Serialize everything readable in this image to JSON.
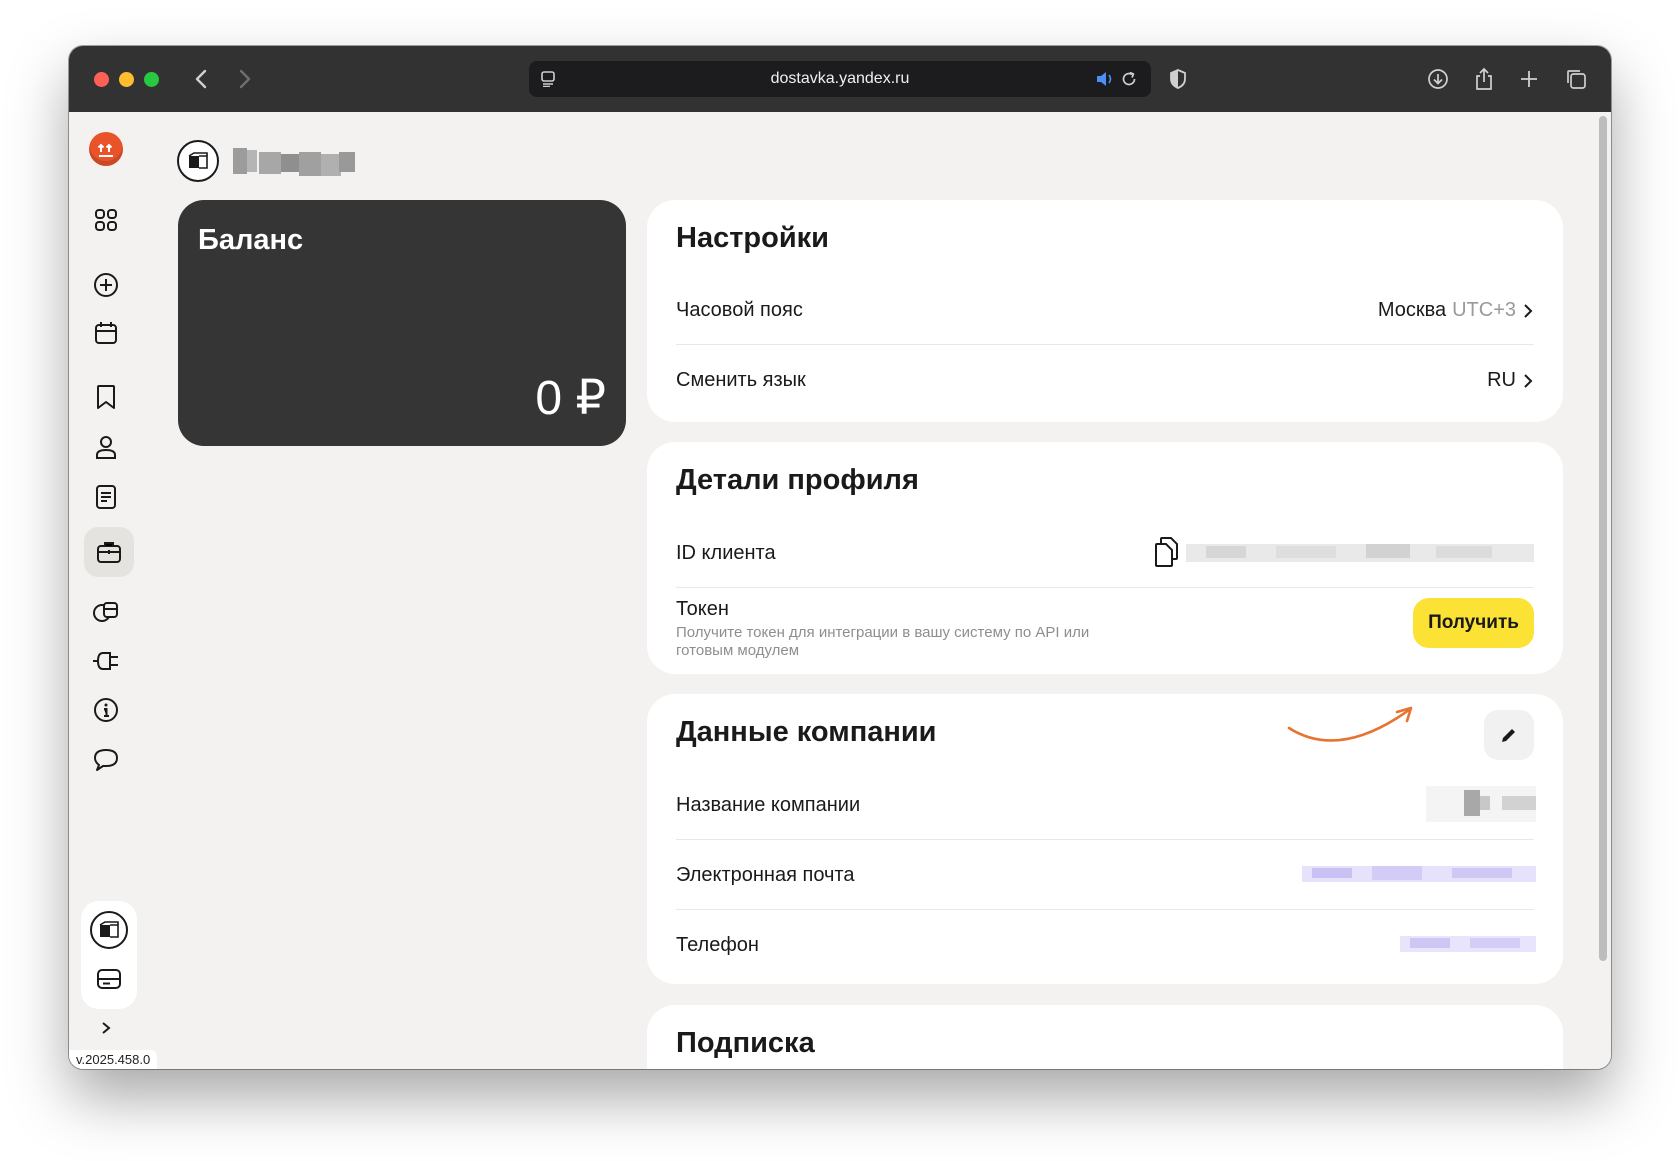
{
  "browser": {
    "url": "dostavka.yandex.ru"
  },
  "header": {
    "account_name_blurred": "Тестди"
  },
  "balance": {
    "title": "Баланс",
    "value": "0 ₽"
  },
  "settings": {
    "title": "Настройки",
    "timezone_label": "Часовой пояс",
    "timezone_city": "Москва",
    "timezone_offset": "UTC+3",
    "language_label": "Сменить язык",
    "language_value": "RU"
  },
  "profile": {
    "title": "Детали профиля",
    "client_id_label": "ID клиента",
    "token_label": "Токен",
    "token_hint": "Получите токен для интеграции в вашу систему по API или готовым модулем",
    "get_button": "Получить"
  },
  "company": {
    "title": "Данные компании",
    "name_label": "Название компании",
    "email_label": "Электронная почта",
    "phone_label": "Телефон"
  },
  "subscription": {
    "title": "Подписка"
  },
  "sidebar": {
    "version": "v.2025.458.0",
    "items": [
      "dashboard-icon",
      "add-order-icon",
      "calendar-icon",
      "bookmark-icon",
      "user-icon",
      "document-icon",
      "briefcase-icon",
      "boxes-icon",
      "plug-icon",
      "info-icon",
      "chat-icon"
    ],
    "active": "briefcase-icon"
  },
  "colors": {
    "accent_yellow": "#fbe235",
    "logo_orange": "#e8532a",
    "annotation_arrow": "#e8722f"
  }
}
